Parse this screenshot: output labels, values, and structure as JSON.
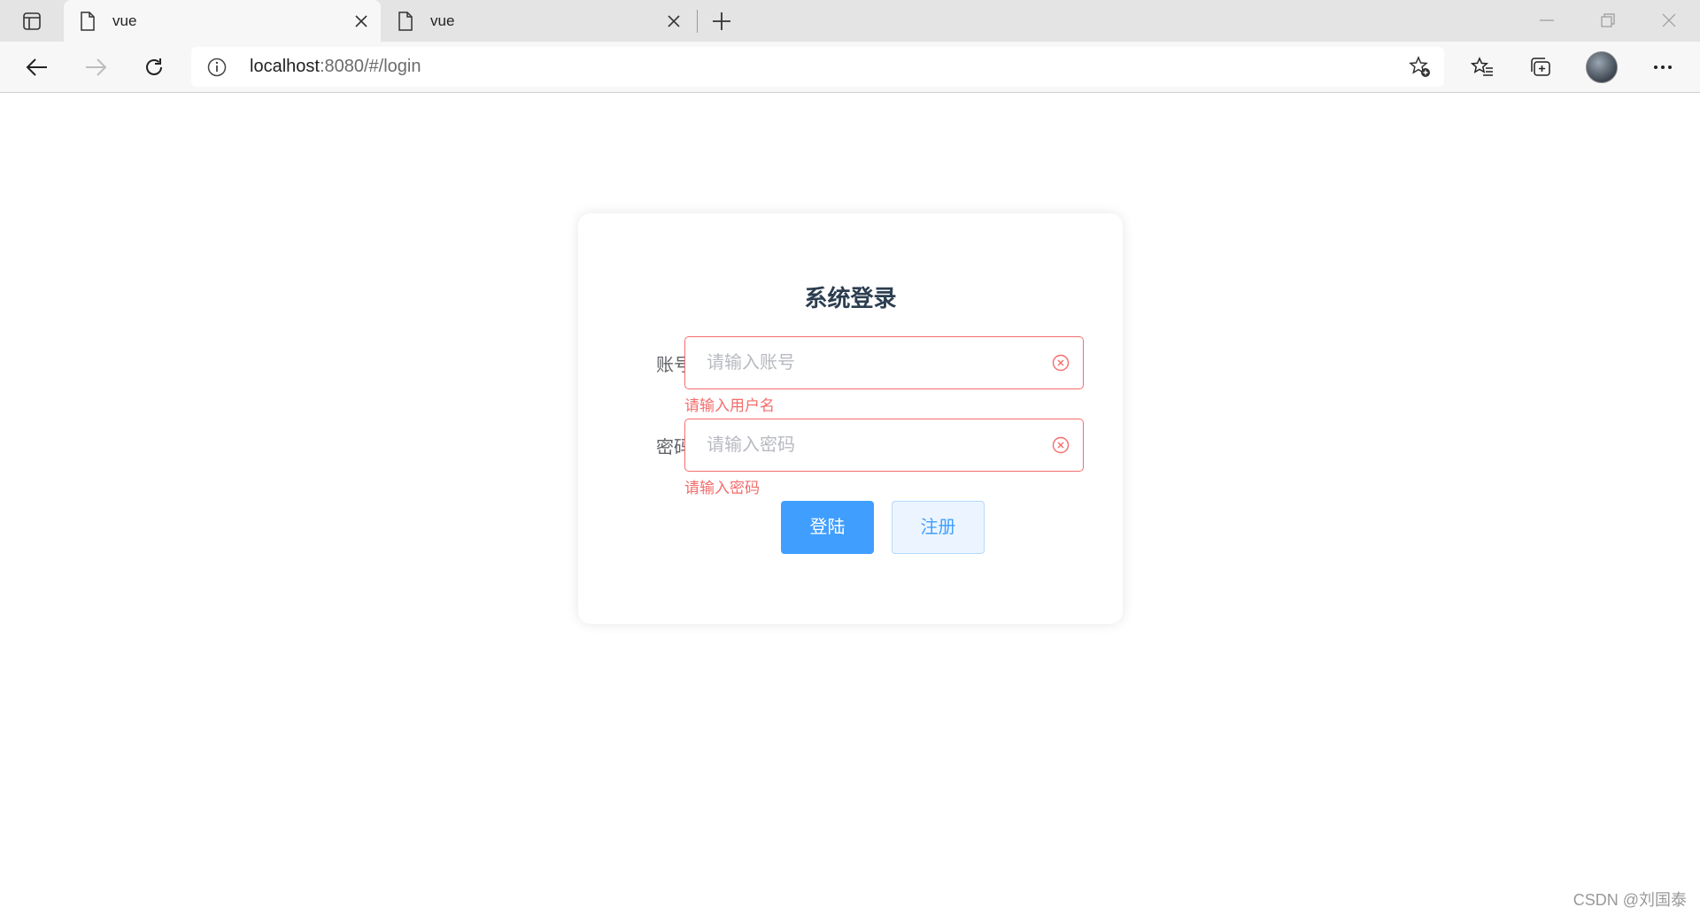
{
  "browser": {
    "tabs": [
      {
        "title": "vue",
        "active": true
      },
      {
        "title": "vue",
        "active": false
      }
    ],
    "address": {
      "host": "localhost",
      "path": ":8080/#/login"
    }
  },
  "login": {
    "title": "系统登录",
    "username": {
      "label": "账号",
      "placeholder": "请输入账号",
      "value": "",
      "error": "请输入用户名"
    },
    "password": {
      "label": "密码",
      "placeholder": "请输入密码",
      "value": "",
      "error": "请输入密码"
    },
    "login_button": "登陆",
    "register_button": "注册"
  },
  "watermark": "CSDN @刘国泰",
  "colors": {
    "primary": "#409eff",
    "error": "#f56c6c",
    "title": "#2c3e50"
  }
}
